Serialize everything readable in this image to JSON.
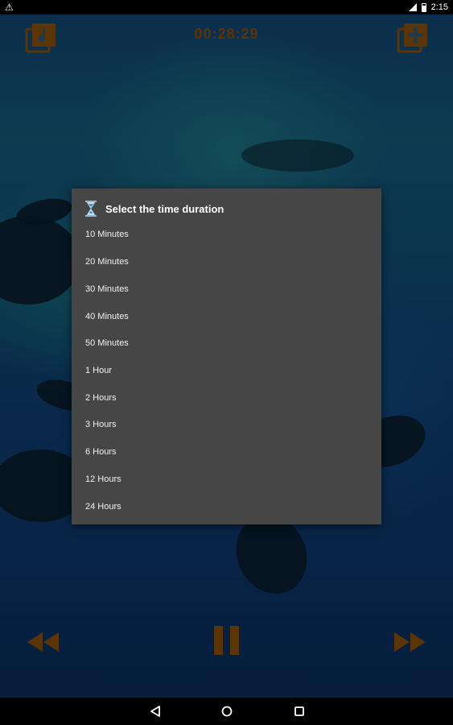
{
  "status_bar": {
    "time": "2:15",
    "warning_icon": "warning-icon",
    "signal_icon": "signal-icon",
    "battery_icon": "battery-icon"
  },
  "toolbar": {
    "playlist_icon": "music-library-icon",
    "add_icon": "add-to-library-icon",
    "timer": "00:28:29",
    "accent_color": "#5b3408"
  },
  "dialog": {
    "icon": "hourglass-icon",
    "title": "Select the time duration",
    "options": [
      "10 Minutes",
      "20 Minutes",
      "30 Minutes",
      "40 Minutes",
      "50 Minutes",
      "1 Hour",
      "2 Hours",
      "3 Hours",
      "6 Hours",
      "12 Hours",
      "24 Hours"
    ],
    "background": "#464646"
  },
  "controls": {
    "rewind_icon": "rewind-icon",
    "pause_icon": "pause-icon",
    "forward_icon": "fast-forward-icon"
  },
  "nav_bar": {
    "back_icon": "back-icon",
    "home_icon": "home-icon",
    "recents_icon": "recents-icon"
  }
}
